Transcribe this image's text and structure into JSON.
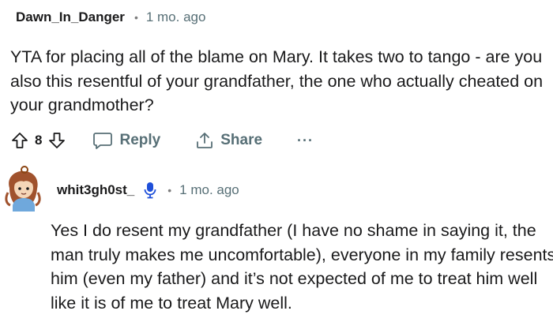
{
  "comment1": {
    "author": "Dawn_In_Danger",
    "separator": "•",
    "time": "1 mo. ago",
    "body": "YTA for placing all of the blame on Mary. It takes two to tango - are you also this resentful of your grandfather, the one who actually cheated on your grandmother?",
    "vote_count": "8",
    "reply_label": "Reply",
    "share_label": "Share",
    "more_label": "···",
    "icons": {
      "upvote": "arrow-up-outline-icon",
      "downvote": "arrow-down-outline-icon",
      "reply": "chat-bubble-icon",
      "share": "share-upload-icon"
    }
  },
  "comment2": {
    "author": "whit3gh0st_",
    "separator": "•",
    "time": "1 mo. ago",
    "body": "Yes I do resent my grandfather (I have no shame in saying it, the man truly makes me uncomfortable), everyone in my family resents him (even my father) and it’s not expected of me to treat him well like it is of me to treat Mary well.",
    "icons": {
      "avatar": "cartoon-girl-avatar",
      "flair": "microphone-icon"
    }
  },
  "colors": {
    "text": "#1a1a1b",
    "meta": "#576f76",
    "flair_blue": "#1e4fd9"
  }
}
